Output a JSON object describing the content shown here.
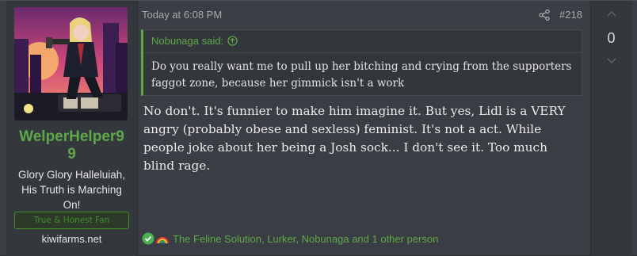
{
  "user": {
    "name": "WelperHelper99",
    "title": "Glory Glory Halleluiah, His Truth is Marching On!",
    "banner": "True & Honest Fan",
    "site": "kiwifarms.net"
  },
  "post": {
    "date": "Today at 6:08 PM",
    "number": "#218",
    "quote_author": "Nobunaga said:",
    "quote_text": "Do you really want me to pull up her bitching and crying from the supporters faggot zone, because her gimmick isn't a work",
    "body": "No don't. It's funnier to make him imagine it. But yes, Lidl is a VERY angry (probably obese and sexless) feminist. It's not a act. While people joke about her being a Josh sock... I don't see it. Too much blind rage.",
    "reactions_text": "The Feline Solution, Lurker, Nobunaga and 1 other person"
  },
  "vote": {
    "count": "0"
  },
  "icons": {
    "share": "share-icon",
    "quote_jump": "arrow-up-circle-icon",
    "reaction_1": "check-circle-icon",
    "reaction_2": "rainbow-icon",
    "vote_up": "chevron-up-icon",
    "vote_down": "chevron-down-icon"
  },
  "colors": {
    "accent": "#5fa84a",
    "background": "#3a3d43"
  }
}
